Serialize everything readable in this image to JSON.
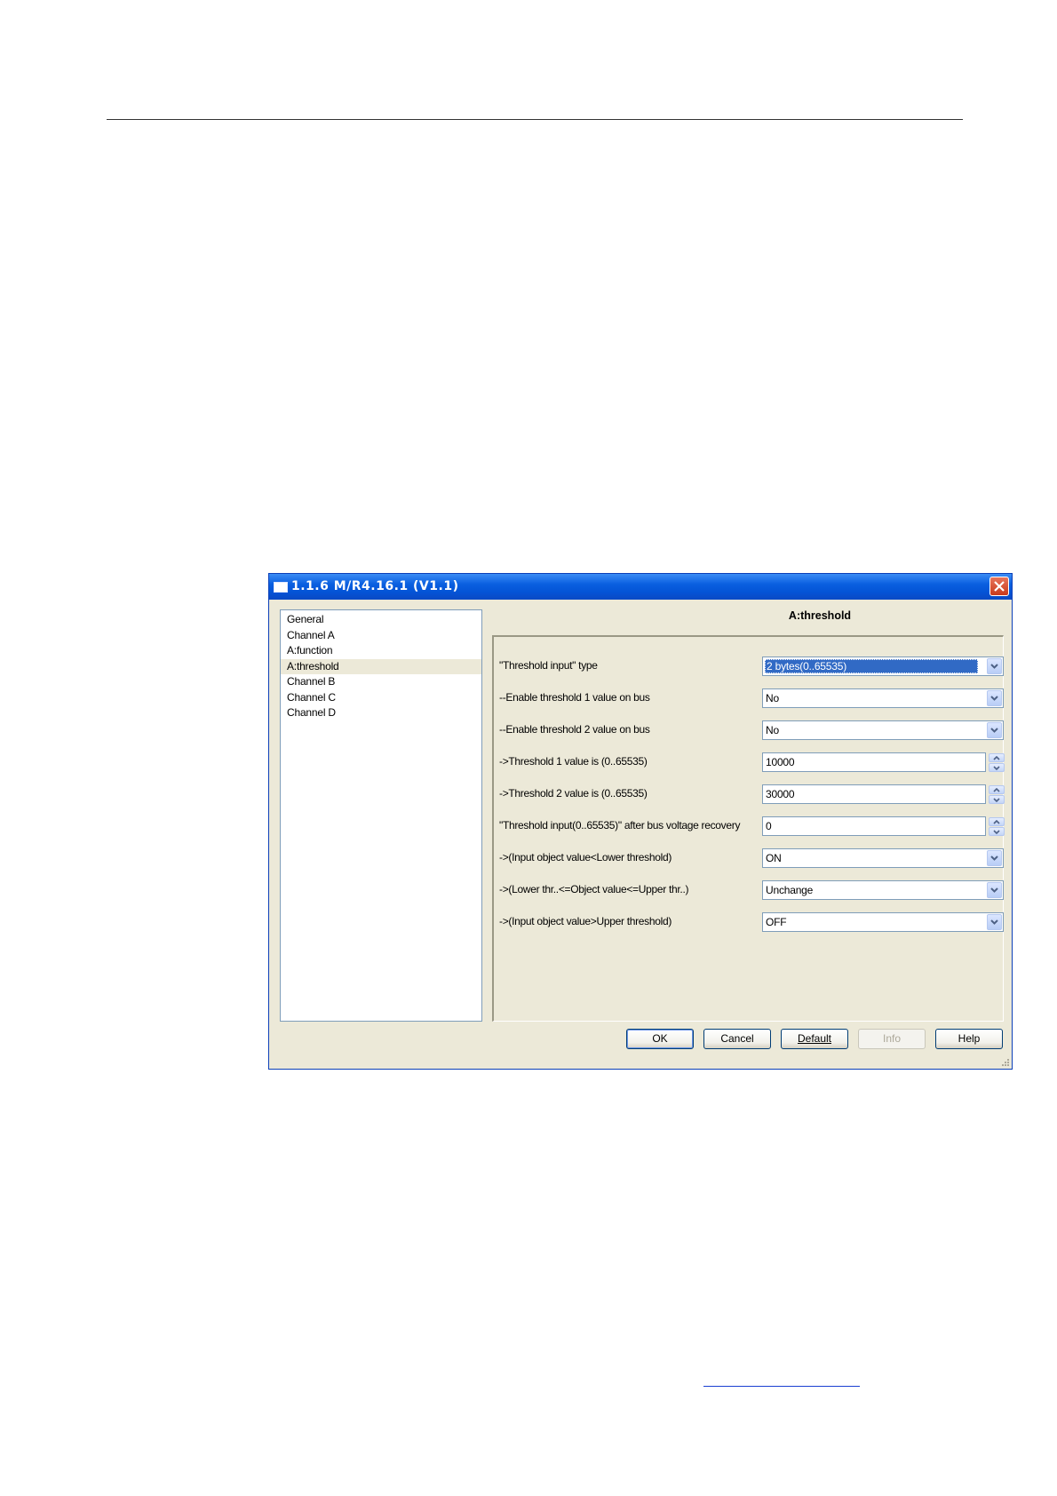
{
  "window": {
    "title": "1.1.6 M/R4.16.1 (V1.1)",
    "close_icon": "close-icon"
  },
  "tree": {
    "items": [
      {
        "label": "General",
        "selected": false
      },
      {
        "label": "Channel A",
        "selected": false
      },
      {
        "label": "A:function",
        "selected": false
      },
      {
        "label": "A:threshold",
        "selected": true
      },
      {
        "label": "Channel B",
        "selected": false
      },
      {
        "label": "Channel C",
        "selected": false
      },
      {
        "label": "Channel D",
        "selected": false
      }
    ]
  },
  "panel": {
    "title": "A:threshold",
    "rows": [
      {
        "label": "\"Threshold input\" type",
        "type": "dropdown",
        "value": "2 bytes(0..65535)",
        "focused": true
      },
      {
        "label": "--Enable threshold 1 value on bus",
        "type": "dropdown",
        "value": "No"
      },
      {
        "label": "--Enable threshold 2 value on bus",
        "type": "dropdown",
        "value": "No"
      },
      {
        "label": "->Threshold 1 value is (0..65535)",
        "type": "spinner",
        "value": "10000"
      },
      {
        "label": "->Threshold 2 value is (0..65535)",
        "type": "spinner",
        "value": "30000"
      },
      {
        "label": "\"Threshold input(0..65535)\" after bus voltage recovery",
        "type": "spinner",
        "value": "0"
      },
      {
        "label": "->(Input object value<Lower threshold)",
        "type": "dropdown",
        "value": "ON"
      },
      {
        "label": "->(Lower thr..<=Object value<=Upper thr..)",
        "type": "dropdown",
        "value": "Unchange"
      },
      {
        "label": "->(Input object value>Upper threshold)",
        "type": "dropdown",
        "value": "OFF"
      }
    ]
  },
  "buttons": {
    "ok": "OK",
    "cancel": "Cancel",
    "default": "Default",
    "info": "Info",
    "help": "Help"
  },
  "colors": {
    "titlebar": "#0454d6",
    "dialog_bg": "#ece9d8",
    "selection": "#316ac5"
  }
}
